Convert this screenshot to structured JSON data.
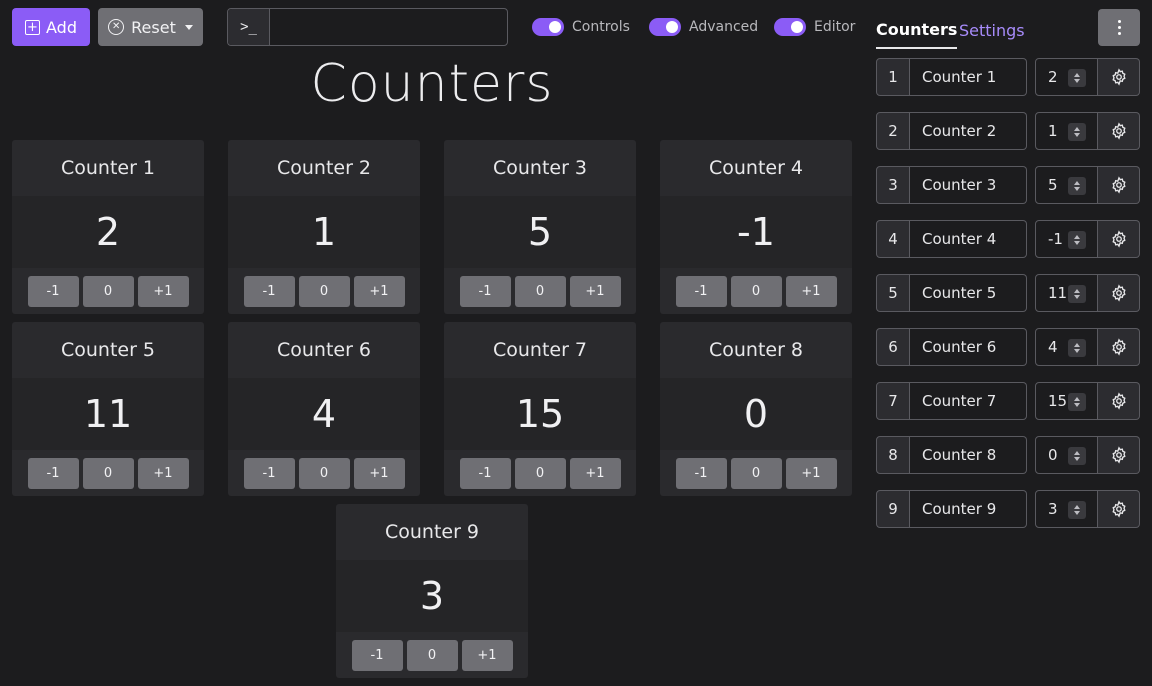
{
  "toolbar": {
    "add_label": "Add",
    "reset_label": "Reset",
    "prompt_symbol": ">_",
    "command_value": ""
  },
  "toggles": [
    {
      "label": "Controls",
      "on": true
    },
    {
      "label": "Advanced",
      "on": true
    },
    {
      "label": "Editor",
      "on": true
    }
  ],
  "tabs": [
    {
      "label": "Counters",
      "active": true
    },
    {
      "label": "Settings",
      "active": false
    }
  ],
  "title": "Counters",
  "button_labels": {
    "dec": "-1",
    "zero": "0",
    "inc": "+1"
  },
  "counters": [
    {
      "index": "1",
      "name": "Counter 1",
      "value": "2"
    },
    {
      "index": "2",
      "name": "Counter 2",
      "value": "1"
    },
    {
      "index": "3",
      "name": "Counter 3",
      "value": "5"
    },
    {
      "index": "4",
      "name": "Counter 4",
      "value": "-1"
    },
    {
      "index": "5",
      "name": "Counter 5",
      "value": "11"
    },
    {
      "index": "6",
      "name": "Counter 6",
      "value": "4"
    },
    {
      "index": "7",
      "name": "Counter 7",
      "value": "15"
    },
    {
      "index": "8",
      "name": "Counter 8",
      "value": "0"
    },
    {
      "index": "9",
      "name": "Counter 9",
      "value": "3"
    }
  ],
  "colors": {
    "accent": "#8b5cf6",
    "background": "#1c1c1e",
    "card": "#2a2a2d",
    "button": "#6f6f74"
  },
  "icons": {
    "add": "plus-square-icon",
    "reset": "x-circle-icon",
    "menu": "more-vertical-icon",
    "settings": "gear-icon"
  }
}
